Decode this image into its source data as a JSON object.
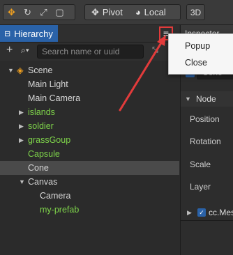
{
  "toolbar": {
    "pivot_label": "Pivot",
    "local_label": "Local",
    "mode_3d": "3D"
  },
  "hierarchy": {
    "tab_label": "Hierarchy",
    "search_placeholder": "Search name or uuid",
    "tree": [
      {
        "label": "Scene",
        "color": "#d6d6d6"
      },
      {
        "label": "Main Light",
        "color": "#d6d6d6"
      },
      {
        "label": "Main Camera",
        "color": "#d6d6d6"
      },
      {
        "label": "islands",
        "color": "#7ed34a"
      },
      {
        "label": "soldier",
        "color": "#7ed34a"
      },
      {
        "label": "grassGoup",
        "color": "#7ed34a"
      },
      {
        "label": "Capsule",
        "color": "#7ed34a"
      },
      {
        "label": "Cone",
        "color": "#d6d6d6",
        "selected": true
      },
      {
        "label": "Canvas",
        "color": "#d6d6d6"
      },
      {
        "label": "Camera",
        "color": "#d6d6d6"
      },
      {
        "label": "my-prefab",
        "color": "#7ed34a"
      }
    ]
  },
  "popup_menu": {
    "items": [
      "Popup",
      "Close"
    ]
  },
  "inspector": {
    "tab_label": "Inspector",
    "node_name": "Cone",
    "node_section": "Node",
    "props": [
      "Position",
      "Rotation",
      "Scale",
      "Layer"
    ],
    "component": "cc.Mesh"
  },
  "colors": {
    "accent": "#2a62a8",
    "prefab_green": "#7ed34a",
    "highlight_red": "#e23b3b",
    "move_tool_orange": "#f0a020"
  }
}
